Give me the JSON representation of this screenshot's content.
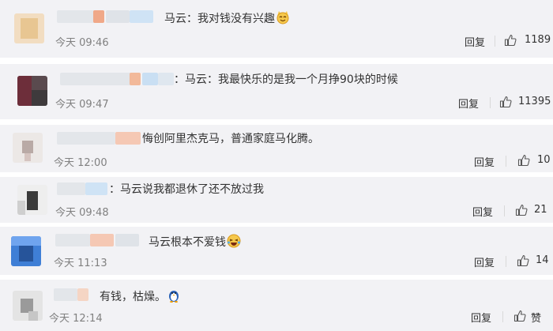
{
  "comments": [
    {
      "text": "马云：我对钱没有兴趣",
      "time": "今天 09:46",
      "reply": "回复",
      "likes": "1189"
    },
    {
      "text": "：马云：我最快乐的是我一个月挣90块的时候",
      "time": "今天 09:47",
      "reply": "回复",
      "likes": "11395"
    },
    {
      "text": "悔创阿里杰克马，普通家庭马化腾。",
      "time": "今天 12:00",
      "reply": "回复",
      "likes": "10"
    },
    {
      "text": "：马云说我都退休了还不放过我",
      "time": "今天 09:48",
      "reply": "回复",
      "likes": "21"
    },
    {
      "text": "马云根本不爱钱",
      "time": "今天 11:13",
      "reply": "回复",
      "likes": "14"
    },
    {
      "text": "有钱，枯燥。",
      "time": "今天 12:14",
      "reply": "回复",
      "likes": "赞"
    }
  ],
  "icons": {
    "like": "thumbs-up-icon",
    "emoji_cat": "smiling-cat-emoji-icon",
    "emoji_laugh": "laughing-emoji-icon",
    "emoji_penguin": "penguin-emoji-icon"
  }
}
